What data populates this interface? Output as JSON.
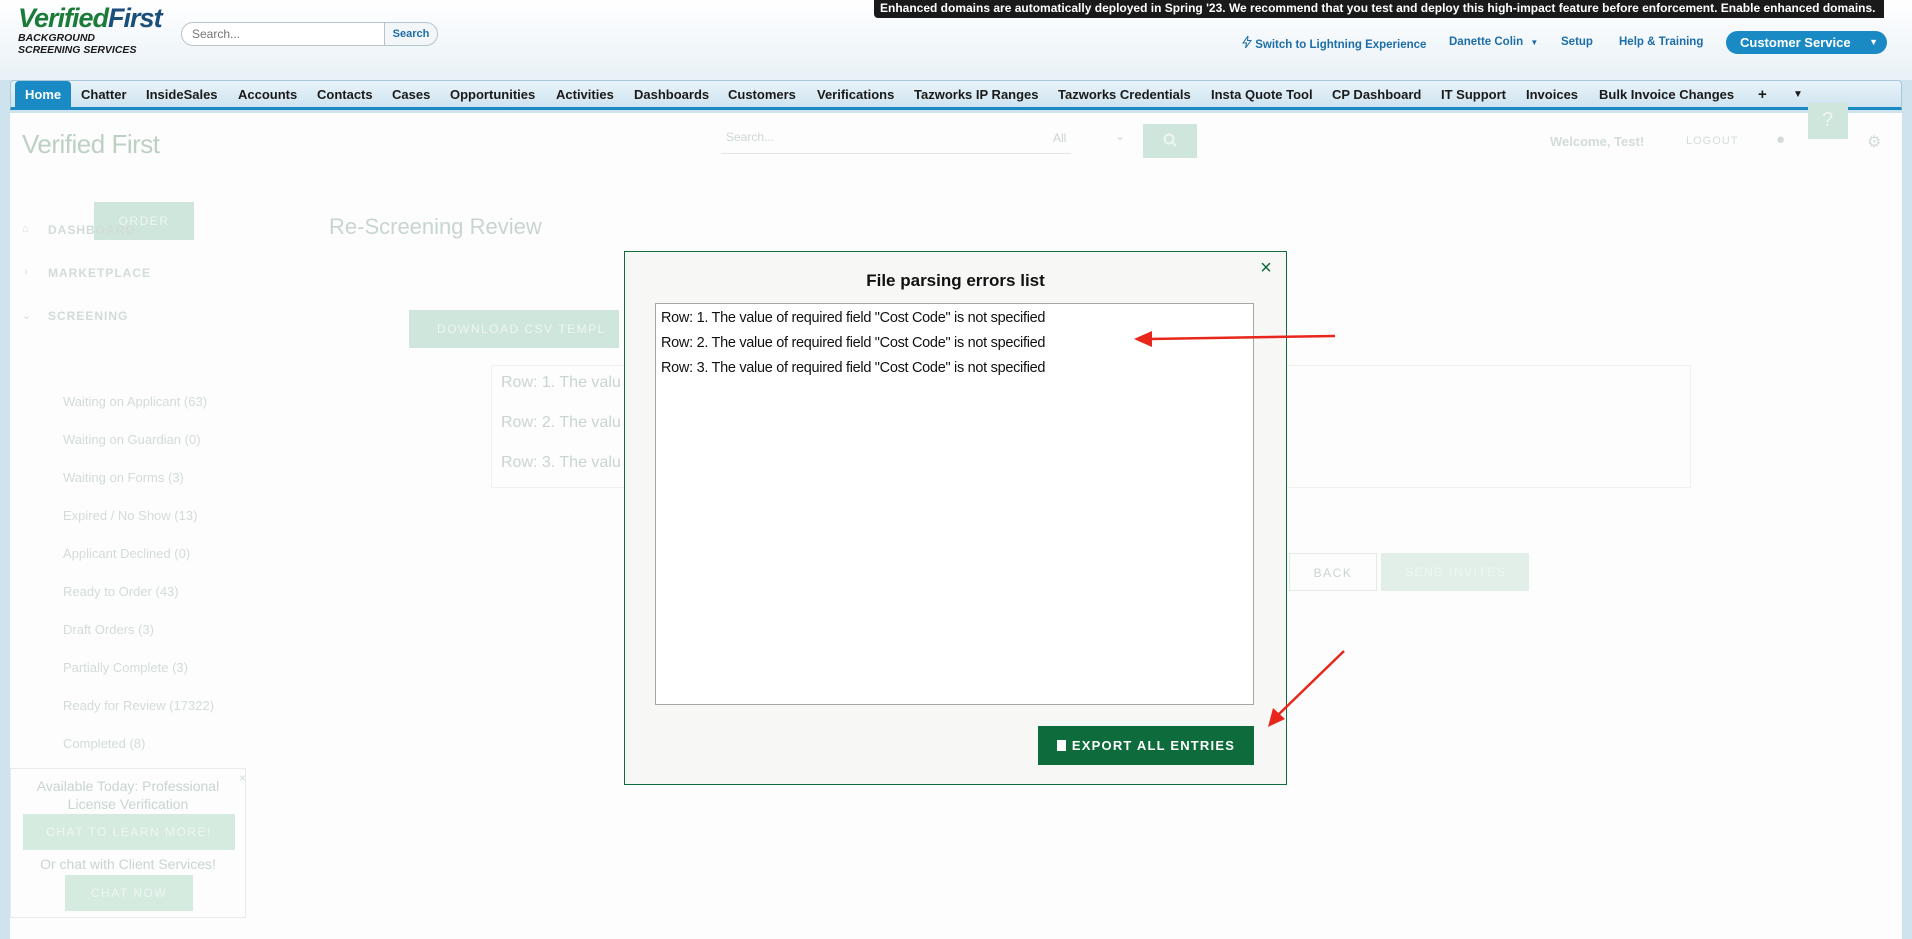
{
  "header": {
    "logo_brand_verified": "Verified",
    "logo_brand_first": "First",
    "logo_tagline_1": "BACKGROUND",
    "logo_tagline_2": "SCREENING SERVICES",
    "search_placeholder": "Search...",
    "search_button": "Search",
    "banner": "Enhanced domains are automatically deployed in Spring '23. We recommend that you test and deploy this high-impact feature before enforcement. Enable enhanced domains.",
    "links": {
      "lightning": "Switch to Lightning Experience",
      "user": "Danette Colin",
      "setup": "Setup",
      "help": "Help & Training"
    },
    "app_switcher": "Customer Service"
  },
  "tabs": [
    "Home",
    "Chatter",
    "InsideSales",
    "Accounts",
    "Contacts",
    "Cases",
    "Opportunities",
    "Activities",
    "Dashboards",
    "Customers",
    "Verifications",
    "Tazworks IP Ranges",
    "Tazworks Credentials",
    "Insta Quote Tool",
    "CP Dashboard",
    "IT Support",
    "Invoices",
    "Bulk Invoice Changes",
    "+"
  ],
  "background_page": {
    "logo": "Verified First",
    "search_placeholder": "Search...",
    "search_scope": "All",
    "welcome": "Welcome, Test!",
    "logout": "LOGOUT",
    "order_button": "ORDER",
    "page_title": "Re-Screening Review",
    "nav": {
      "dashboard": "DASHBOARD",
      "marketplace": "MARKETPLACE",
      "screening": "SCREENING",
      "items": [
        "Waiting on Applicant (63)",
        "Waiting on Guardian (0)",
        "Waiting on Forms (3)",
        "Expired / No Show (13)",
        "Applicant Declined (0)",
        "Ready to Order (43)",
        "Draft Orders (3)",
        "Partially Complete (3)",
        "Ready for Review (17322)",
        "Completed (8)"
      ]
    },
    "download_button": "DOWNLOAD CSV TEMPL",
    "error_preview": [
      "Row: 1. The valu",
      "Row: 2. The valu",
      "Row: 3. The valu"
    ],
    "back_button": "BACK",
    "send_button": "SEND INVITES",
    "chat": {
      "promo": "Available Today: Professional License Verification",
      "learn_button": "CHAT TO LEARN MORE!",
      "or_text": "Or chat with Client Services!",
      "chat_button": "CHAT NOW"
    }
  },
  "modal": {
    "title": "File parsing errors list",
    "close_icon": "×",
    "errors": [
      "Row: 1. The value of required field \"Cost Code\" is not specified",
      "Row: 2. The value of required field \"Cost Code\" is not specified",
      "Row: 3. The value of required field \"Cost Code\" is not specified"
    ],
    "export_button": "EXPORT ALL ENTRIES"
  },
  "colors": {
    "salesforce_blue": "#1a8ac4",
    "brand_green": "#0e6b3c",
    "annotation_red": "#e8261b"
  },
  "icons": [
    "lightning-bolt-icon",
    "chevron-down-icon",
    "close-icon",
    "document-icon",
    "search-icon",
    "help-icon",
    "gear-icon",
    "clock-icon"
  ]
}
